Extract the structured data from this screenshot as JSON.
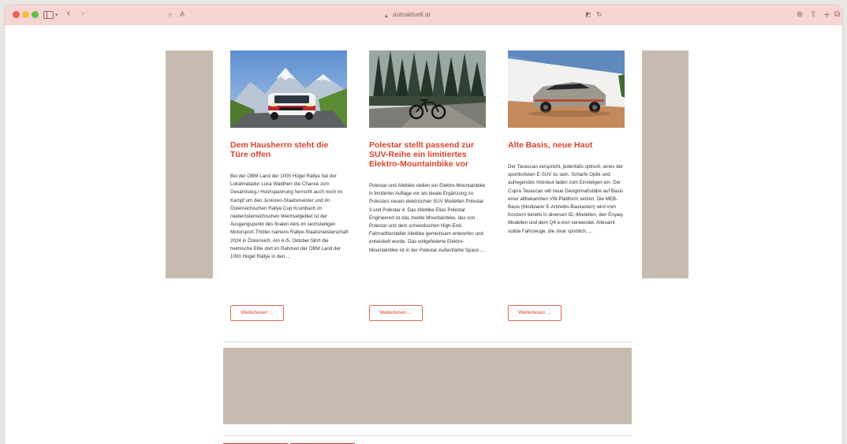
{
  "browser": {
    "url": "autoaktuell.at",
    "back_glyph": "‹",
    "forward_glyph": "›",
    "text_size_glyph": "A"
  },
  "colors": {
    "accent": "#d8432b",
    "ad_placeholder": "#c6bbae",
    "toolbar": "#f6d5d2"
  },
  "articles": [
    {
      "title": "Dem Hausherrn steht die Türe offen",
      "text": "Bei der OBM Land der 1000 Hügel Rallye hat der Lokalmatador Luca Waldherr die Chance zum Gesamtsieg./ Hochspannung herrscht auch noch im Kampf um den Junioren-Staatsmeister und im Österreichischen Rallye Cup Krumbach im niederösterreichischen Wechselgebiet ist der Ausgangspunkt des finalen Akts im sechsteiligen Motorsport-Thriller namens Rallye-Staatsmeisterschaft 2024 in Österreich. Am 4./5. Oktober fährt die heimische Elite dort im Rahmen der OBM Land der 1000 Hügel Rallye in den ...",
      "button": "Weiterlesen ...",
      "image": "rally-car-photo"
    },
    {
      "title": "Polestar stellt passend zur SUV-Reihe ein limitiertes Elektro-Mountainbike vor",
      "text": "Polestar und Allebike stellen ein Elektro-Mountainbike in limitierter Auflage vor als ideale Ergänzung zu Polestars neuen elektrischen SUV Modellen Polestar 3 und Polestar 4. Das Allebike Elias Polestar Engineered ist das zweite Mountainbike, das von Polestar und dem schwedischen High-End-Fahrradhersteller Allebike gemeinsam entworfen und entwickelt wurde. Das vollgefederte Elektro-Mountainbike ist in der Polestar Außenfarbe Space ...",
      "button": "Weiterlesen ...",
      "image": "mountain-bike-photo"
    },
    {
      "title": "Alte Basis, neue Haut",
      "text": "Der Tavascan verspricht, jedenfalls optisch, eines der sportlichsten E-SUV zu sein. Scharfe Optik und aufregendes Interieur laden zum Einsteigen ein. Der Cupra Tavascan will neue Designmaßstäbe auf Basis einer altbekannten VW-Plattform setzen. Die MEB-Basis (Modularer E-Antriebs-Baukasten) wird vom Konzern bereits in diversen ID.-Modellen, den Enyaq-Modellen und dem Q4 e-tron verwendet. Allesamt solide Fahrzeuge, die zwar sportlich, ...",
      "button": "Weiterlesen ...",
      "image": "cupra-suv-photo"
    }
  ]
}
